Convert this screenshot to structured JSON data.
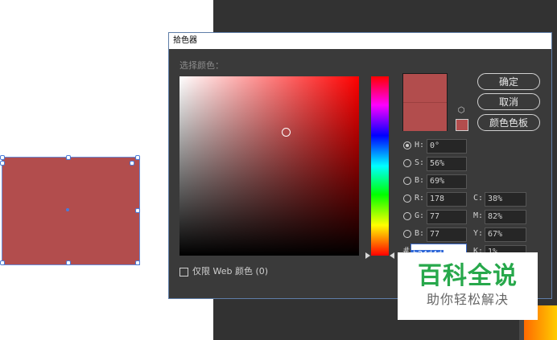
{
  "dialog": {
    "title": "拾色器",
    "section_label": "选择颜色：",
    "buttons": {
      "ok": "确定",
      "cancel": "取消",
      "swatches": "颜色色板"
    },
    "hsb": [
      {
        "label": "H:",
        "value": "0°",
        "selected": true
      },
      {
        "label": "S:",
        "value": "56%",
        "selected": false
      },
      {
        "label": "B:",
        "value": "69%",
        "selected": false
      }
    ],
    "rgb": [
      {
        "label": "R:",
        "value": "178"
      },
      {
        "label": "G:",
        "value": "77"
      },
      {
        "label": "B:",
        "value": "77"
      }
    ],
    "cmyk": [
      {
        "label": "C:",
        "value": "38%"
      },
      {
        "label": "M:",
        "value": "82%"
      },
      {
        "label": "Y:",
        "value": "67%"
      },
      {
        "label": "K:",
        "value": "1%"
      }
    ],
    "hex_symbol": "#",
    "hex_value": "b24d4d",
    "web_only_label": "仅限 Web 颜色 (0)"
  },
  "colors": {
    "selected": "#b24d4d",
    "accent": "#2f68d8"
  },
  "watermark": {
    "title": "百科全说",
    "subtitle": "助你轻松解决"
  }
}
